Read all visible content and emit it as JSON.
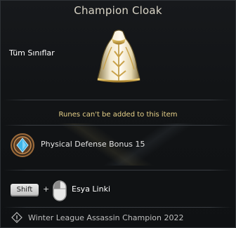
{
  "tooltip": {
    "title": "Champion Cloak",
    "class_restriction": "Tüm Sınıflar",
    "item_icon": "cloak-icon",
    "runes_note": "Runes can't be added to this item",
    "bonus": {
      "icon": "defense-gem-icon",
      "text": "Physical Defense Bonus 15"
    },
    "link_hint": {
      "key": "Shift",
      "plus": "+",
      "mouse_icon": "mouse-left-click-icon",
      "label": "Esya Linki"
    },
    "source": {
      "icon": "info-diamond-icon",
      "text": "Winter League Assassin Champion 2022"
    }
  },
  "colors": {
    "title": "#d9d4c6",
    "runes_note": "#e8d28a",
    "background": "#121416"
  }
}
